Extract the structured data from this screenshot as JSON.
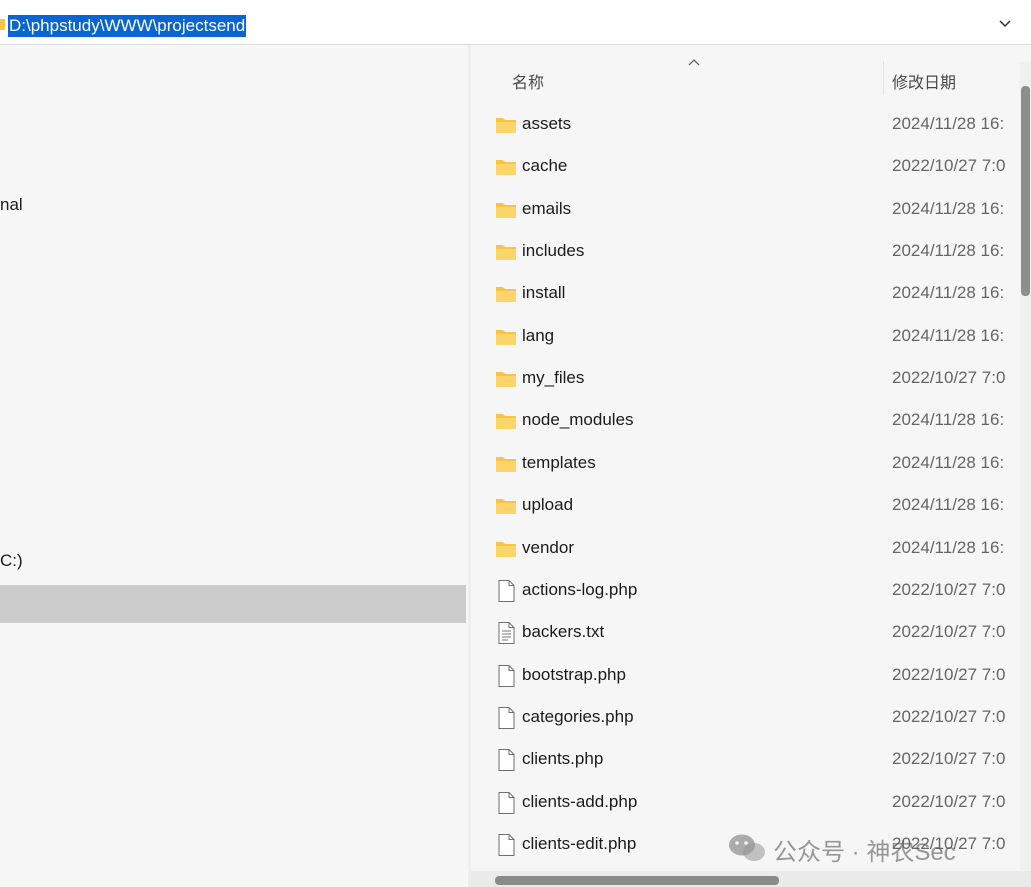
{
  "address_bar": {
    "path": "D:\\phpstudy\\WWW\\projectsend"
  },
  "nav_pane": {
    "items": [
      {
        "label": "nal"
      },
      {
        "label": "C:)"
      }
    ]
  },
  "file_list": {
    "columns": {
      "name": "名称",
      "date_modified": "修改日期"
    },
    "rows": [
      {
        "name": "assets",
        "date": "2024/11/28 16:",
        "type": "folder"
      },
      {
        "name": "cache",
        "date": "2022/10/27 7:0",
        "type": "folder"
      },
      {
        "name": "emails",
        "date": "2024/11/28 16:",
        "type": "folder"
      },
      {
        "name": "includes",
        "date": "2024/11/28 16:",
        "type": "folder"
      },
      {
        "name": "install",
        "date": "2024/11/28 16:",
        "type": "folder"
      },
      {
        "name": "lang",
        "date": "2024/11/28 16:",
        "type": "folder"
      },
      {
        "name": "my_files",
        "date": "2022/10/27 7:0",
        "type": "folder"
      },
      {
        "name": "node_modules",
        "date": "2024/11/28 16:",
        "type": "folder"
      },
      {
        "name": "templates",
        "date": "2024/11/28 16:",
        "type": "folder"
      },
      {
        "name": "upload",
        "date": "2024/11/28 16:",
        "type": "folder"
      },
      {
        "name": "vendor",
        "date": "2024/11/28 16:",
        "type": "folder"
      },
      {
        "name": "actions-log.php",
        "date": "2022/10/27 7:0",
        "type": "file"
      },
      {
        "name": "backers.txt",
        "date": "2022/10/27 7:0",
        "type": "text"
      },
      {
        "name": "bootstrap.php",
        "date": "2022/10/27 7:0",
        "type": "file"
      },
      {
        "name": "categories.php",
        "date": "2022/10/27 7:0",
        "type": "file"
      },
      {
        "name": "clients.php",
        "date": "2022/10/27 7:0",
        "type": "file"
      },
      {
        "name": "clients-add.php",
        "date": "2022/10/27 7:0",
        "type": "file"
      },
      {
        "name": "clients-edit.php",
        "date": "2022/10/27 7:0",
        "type": "file"
      }
    ]
  },
  "watermark": {
    "text": "公众号 · 神农Sec"
  },
  "colors": {
    "selection": "#0a64d2",
    "folder": "#f7c449",
    "nav_selected": "#cccccc"
  }
}
